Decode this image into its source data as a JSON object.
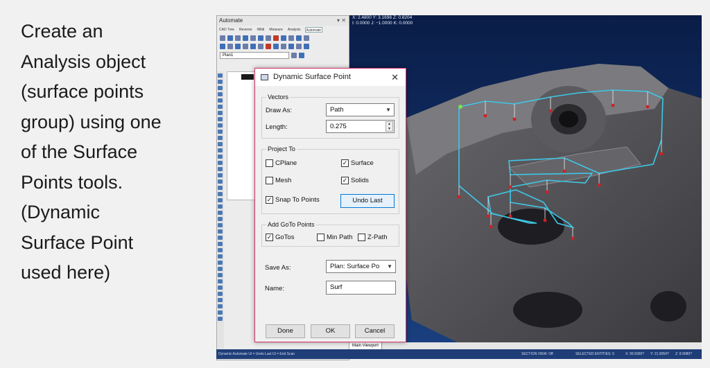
{
  "slide": {
    "text": "Create an\nAnalysis object\n(surface points\ngroup) using one\nof the Surface\nPoints tools.\n(Dynamic\nSurface Point\nused here)"
  },
  "app": {
    "title": "Automate",
    "window_controls": "▾ ✕",
    "tabs": [
      "CAD Tree",
      "Reverse",
      "Wildi",
      "Measure",
      "Analysis",
      "Automate"
    ],
    "plan_value": "Plan1"
  },
  "viewport": {
    "coords_line1": "X: 2.4800  Y: 3.1698  Z: 0.8204",
    "coords_line2": "I: 0.0000  J: −1.0000  K: 0.0000",
    "tab_label": "Main Viewport"
  },
  "status_bar": {
    "left": "Dynamic Automate  Ui = Undo Last  Ui = End Scan",
    "section": "SECTION VIEW: Off",
    "selected": "SELECTED ENTITIES: 0",
    "x": "X: 99.5000?",
    "y": "Y: 21.9054?",
    "z": "Z: 8.9080?"
  },
  "dialog": {
    "title": "Dynamic Surface Point",
    "close_glyph": "✕",
    "vectors": {
      "label": "Vectors",
      "draw_as_label": "Draw As:",
      "draw_as_value": "Path",
      "length_label": "Length:",
      "length_value": "0.275"
    },
    "project_to": {
      "label": "Project To",
      "cplane": "CPlane",
      "surface": "Surface",
      "mesh": "Mesh",
      "solids": "Solids",
      "snap_to_points": "Snap To Points",
      "undo_last": "Undo Last"
    },
    "goto": {
      "label": "Add GoTo Points",
      "gotos": "GoTos",
      "min_path": "Min Path",
      "z_path": "Z-Path"
    },
    "save_as_label": "Save As:",
    "save_as_value": "Plan: Surface Po",
    "name_label": "Name:",
    "name_value": "Surf",
    "buttons": {
      "done": "Done",
      "ok": "OK",
      "cancel": "Cancel"
    }
  },
  "colors": {
    "viewport_bg": "#0d2451",
    "path_line": "#3ec8e8",
    "point_marker": "#d02020",
    "dialog_border": "#d6336c",
    "status_bar": "#1f3e78"
  },
  "icons": {
    "dialog": "dialog-app-icon",
    "close": "close-icon",
    "dropdown": "chevron-down-icon",
    "spinner": "spinner-icon"
  }
}
